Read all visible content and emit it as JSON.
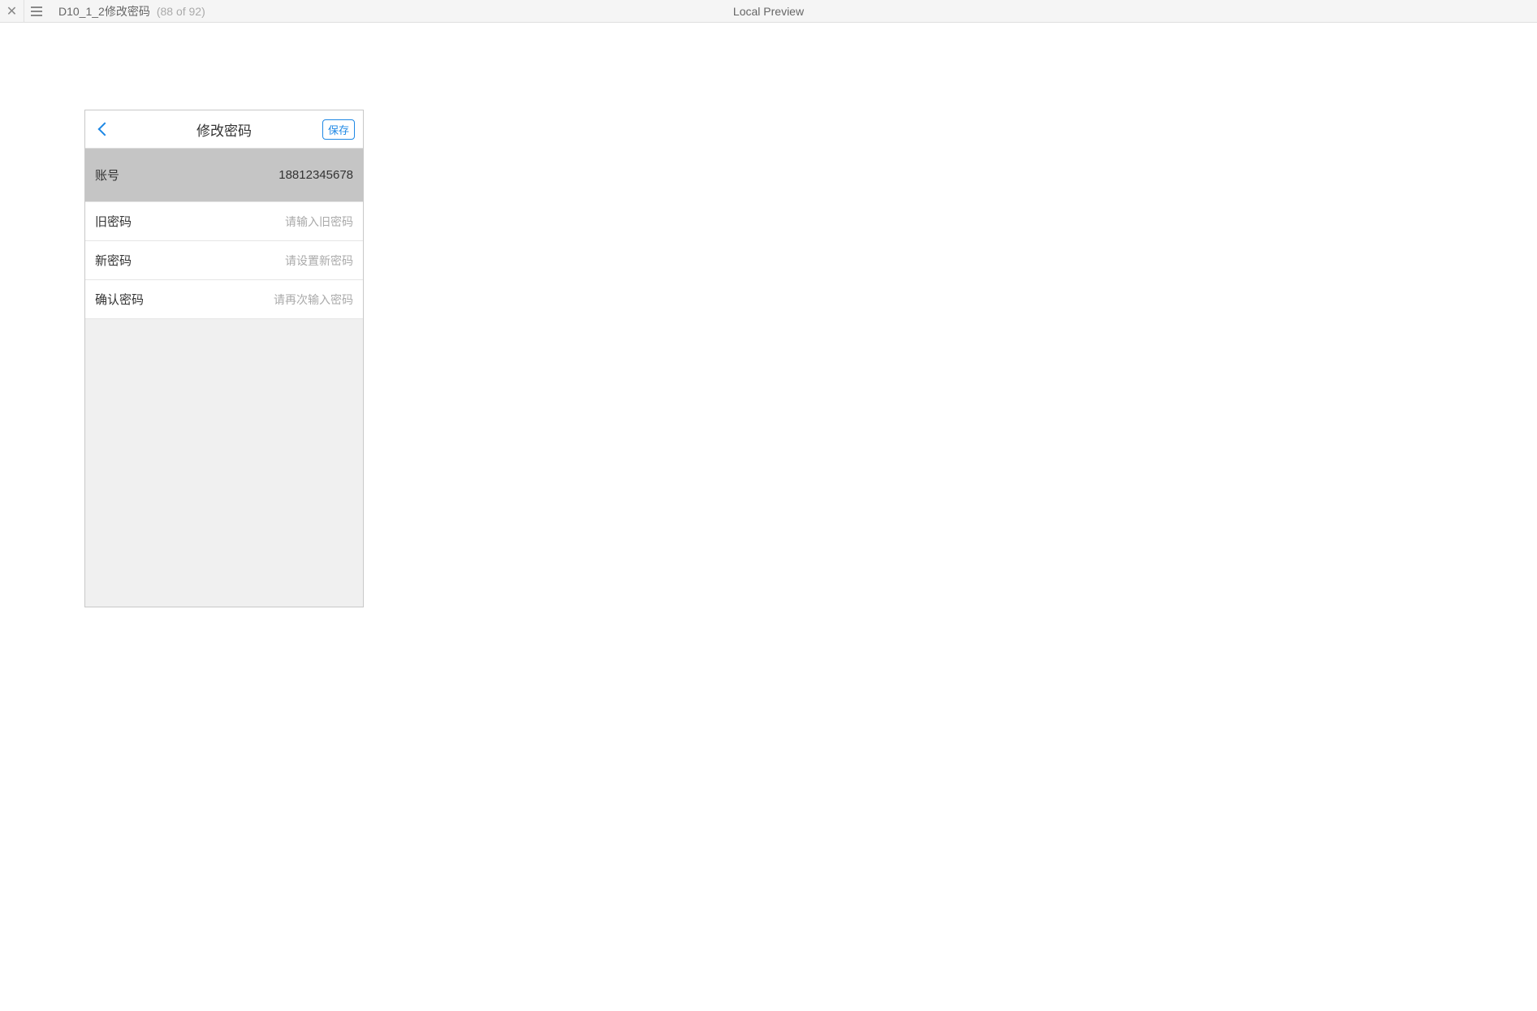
{
  "toolbar": {
    "doc_title": "D10_1_2修改密码",
    "counter": "(88 of 92)",
    "preview_label": "Local Preview"
  },
  "mobile": {
    "header": {
      "title": "修改密码",
      "save_label": "保存"
    },
    "fields": {
      "account": {
        "label": "账号",
        "value": "18812345678"
      },
      "old_password": {
        "label": "旧密码",
        "placeholder": "请输入旧密码"
      },
      "new_password": {
        "label": "新密码",
        "placeholder": "请设置新密码"
      },
      "confirm_password": {
        "label": "确认密码",
        "placeholder": "请再次输入密码"
      }
    }
  }
}
